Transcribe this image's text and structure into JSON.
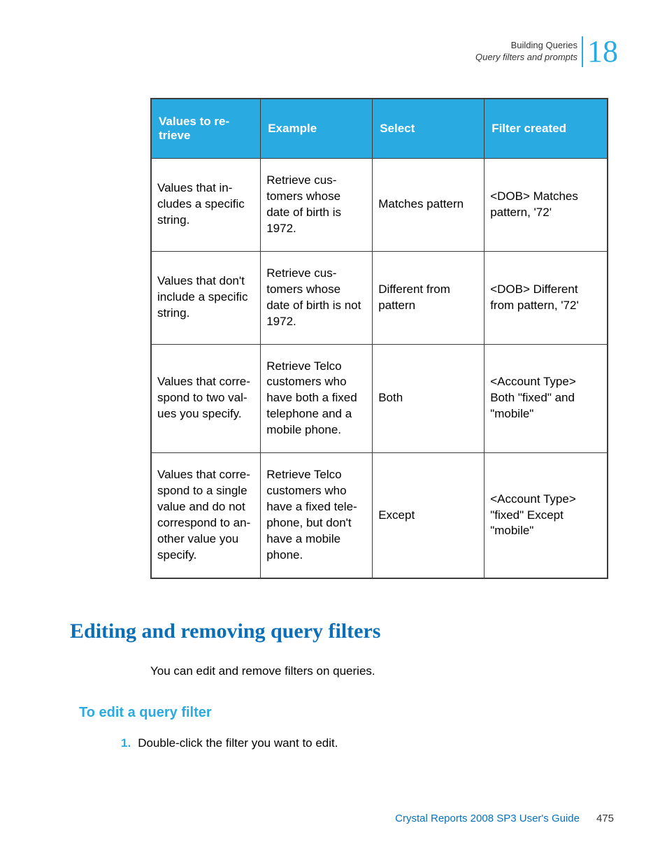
{
  "header": {
    "line1": "Building Queries",
    "line2": "Query filters and prompts",
    "chapter": "18"
  },
  "table": {
    "headers": {
      "col1": "Values to re­trieve",
      "col2": "Example",
      "col3": "Select",
      "col4": "Filter created"
    },
    "rows": [
      {
        "col1": "Values that in­cludes a specific string.",
        "col2": "Retrieve cus­tomers whose date of birth is 1972.",
        "col3": "Matches pattern",
        "col4": "<DOB> Matches pattern, '72'"
      },
      {
        "col1": "Values that don't include a specific string.",
        "col2": "Retrieve cus­tomers whose date of birth is not 1972.",
        "col3": "Different from pattern",
        "col4": "<DOB> Different from pattern, '72'"
      },
      {
        "col1": "Values that corre­spond to two val­ues you specify.",
        "col2": "Retrieve Telco customers who have both a fixed telephone and a mobile phone.",
        "col3": "Both",
        "col4": "<Account Type> Both \"fixed\" and \"mobile\""
      },
      {
        "col1": "Values that corre­spond to a single value and do not correspond to an­other value you specify.",
        "col2": "Retrieve Telco customers who have a fixed tele­phone, but don't have a mobile phone.",
        "col3": "Except",
        "col4": "<Account Type> \"fixed\" Except \"mobile\""
      }
    ]
  },
  "section": {
    "heading": "Editing and removing query filters",
    "intro": "You can edit and remove filters on queries.",
    "subheading": "To edit a query filter",
    "step_num": "1.",
    "step_text": "Double-click the filter you want to edit."
  },
  "footer": {
    "title": "Crystal Reports 2008 SP3 User's Guide",
    "page": "475"
  }
}
